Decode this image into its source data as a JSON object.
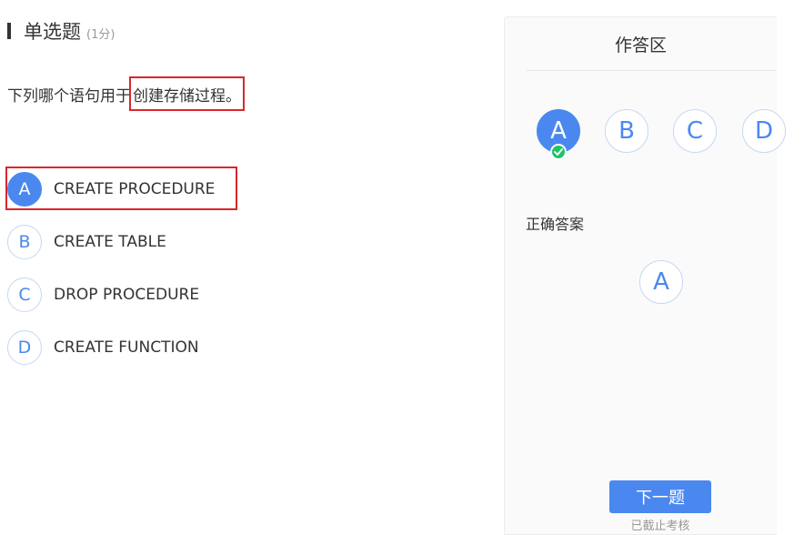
{
  "question": {
    "type_label": "单选题",
    "score": "(1分)",
    "stem_prefix": "下列哪个语句用于",
    "stem_highlight": "创建存储过程。",
    "options": [
      {
        "letter": "A",
        "text": "CREATE PROCEDURE",
        "selected": true
      },
      {
        "letter": "B",
        "text": "CREATE TABLE",
        "selected": false
      },
      {
        "letter": "C",
        "text": "DROP PROCEDURE",
        "selected": false
      },
      {
        "letter": "D",
        "text": "CREATE FUNCTION",
        "selected": false
      }
    ]
  },
  "panel": {
    "title": "作答区",
    "answer_letters": [
      "A",
      "B",
      "C",
      "D"
    ],
    "selected_answer": "A",
    "correct_label": "正确答案",
    "correct_answer": "A",
    "next_button": "下一题",
    "deadline_text": "已截止考核"
  },
  "colors": {
    "accent": "#4a88f0",
    "highlight_border": "#d9262c",
    "check_green": "#20c36a"
  },
  "icons": {
    "check": "check-icon"
  }
}
